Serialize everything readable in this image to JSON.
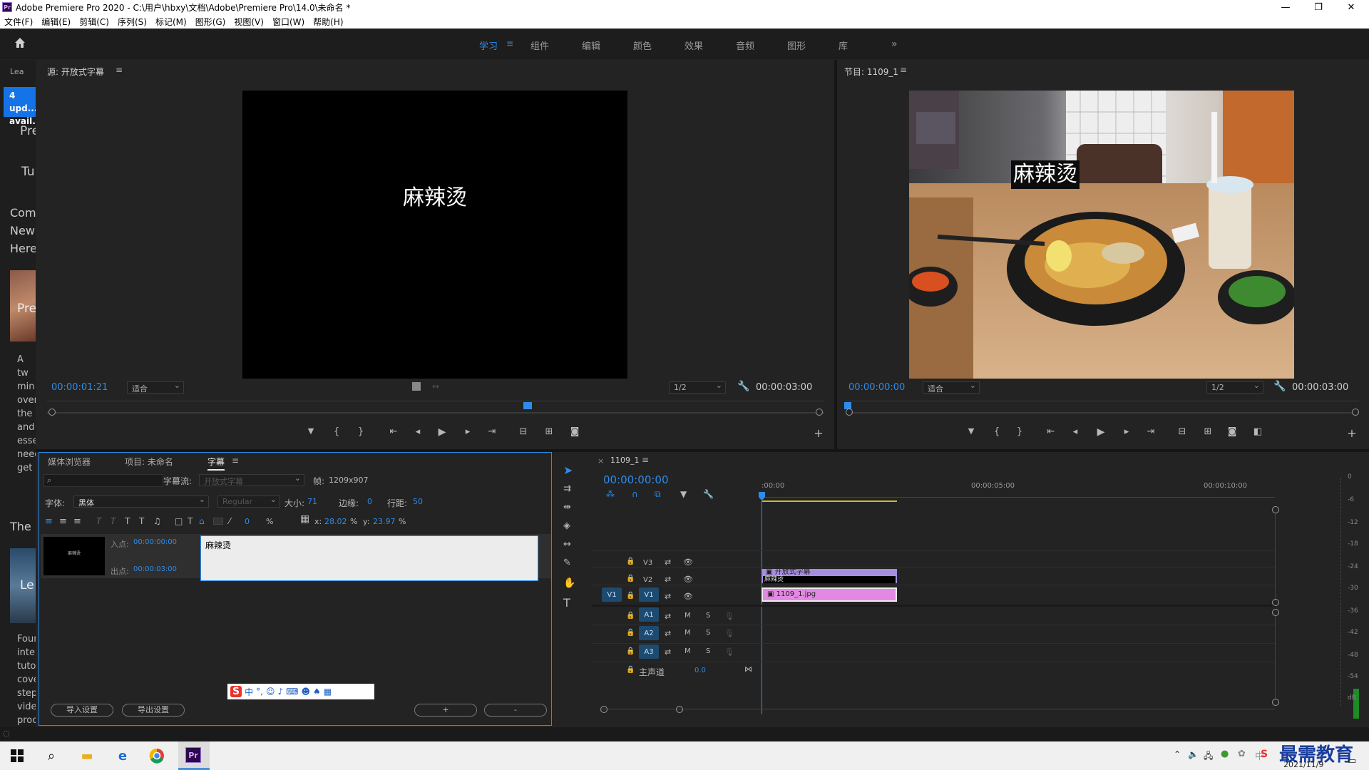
{
  "window": {
    "title": "Adobe Premiere Pro 2020 - C:\\用户\\hbxy\\文档\\Adobe\\Premiere Pro\\14.0\\未命名 *",
    "app_badge": "Pr"
  },
  "menus": [
    "文件(F)",
    "编辑(E)",
    "剪辑(C)",
    "序列(S)",
    "标记(M)",
    "图形(G)",
    "视图(V)",
    "窗口(W)",
    "帮助(H)"
  ],
  "workspaces": {
    "items": [
      "学习",
      "组件",
      "编辑",
      "颜色",
      "效果",
      "音频",
      "图形",
      "库"
    ],
    "active": "学习",
    "more": "»"
  },
  "learn_panel": {
    "tab": "Lea",
    "update_banner": "4 upd... avail...",
    "text_snippets": [
      "Pre",
      "Tu",
      "Com",
      "New",
      "Here",
      "Pre",
      "A tw",
      "min",
      "over",
      "the",
      "and",
      "esse",
      "need",
      "get",
      "The",
      "Le",
      "Four",
      "inte",
      "tuto",
      "cove",
      "step",
      "vide",
      "proc"
    ]
  },
  "source_monitor": {
    "title": "源: 开放式字幕",
    "caption": "麻辣烫",
    "timecode": "00:00:01:21",
    "fit": "适合",
    "resolution": "1/2",
    "duration": "00:00:03:00"
  },
  "program_monitor": {
    "title": "节目: 1109_1",
    "caption": "麻辣烫",
    "timecode": "00:00:00:00",
    "fit": "适合",
    "resolution": "1/2",
    "duration": "00:00:03:00"
  },
  "captions_panel": {
    "tabs": [
      "媒体浏览器",
      "项目: 未命名",
      "字幕"
    ],
    "active_tab": "字幕",
    "stream_label": "字幕流:",
    "stream_value": "开放式字幕",
    "frame_label": "帧:",
    "frame_value": "1209x907",
    "font_label": "字体:",
    "font_value": "黑体",
    "style_value": "Regular",
    "size_label": "大小:",
    "size_value": "71",
    "edge_label": "边缘:",
    "edge_value": "0",
    "leading_label": "行距:",
    "leading_value": "50",
    "opacity_value": "0",
    "opacity_unit": "%",
    "x_label": "x:",
    "x_value": "28.02",
    "y_label": "y:",
    "y_value": "23.97",
    "pct": "%",
    "in_label": "入点:",
    "in_value": "00:00:00:00",
    "out_label": "出点:",
    "out_value": "00:00:03:00",
    "caption_text": "麻辣烫",
    "thumb_text": "麻辣烫",
    "import_btn": "导入设置",
    "export_btn": "导出设置",
    "add_btn": "+",
    "remove_btn": "-"
  },
  "timeline": {
    "sequence": "1109_1",
    "timecode": "00:00:00:00",
    "ruler": [
      ":00:00",
      "00:00:05:00",
      "00:00:10:00"
    ],
    "video_tracks": [
      "V3",
      "V2",
      "V1"
    ],
    "source_patch": "V1",
    "audio_tracks": [
      "A1",
      "A2",
      "A3"
    ],
    "master": "主声道",
    "master_value": "0.0",
    "clips": [
      {
        "track": "V2",
        "name": "开放式字幕",
        "caption": "麻辣烫"
      },
      {
        "track": "V1",
        "name": "1109_1.jpg"
      }
    ],
    "mute": "M",
    "solo": "S"
  },
  "audio_meter": {
    "ticks": [
      "0",
      "-6",
      "-12",
      "-18",
      "-24",
      "-30",
      "-36",
      "-42",
      "-48",
      "-54",
      "dB"
    ]
  },
  "ime_toolbar": {
    "label": "中"
  },
  "taskbar": {
    "watermark": "最需教育",
    "date": "2021/11/9"
  },
  "colors": {
    "accent": "#2d8ceb",
    "video_clip": "#e389e3",
    "caption_clip": "#a58ee0"
  }
}
